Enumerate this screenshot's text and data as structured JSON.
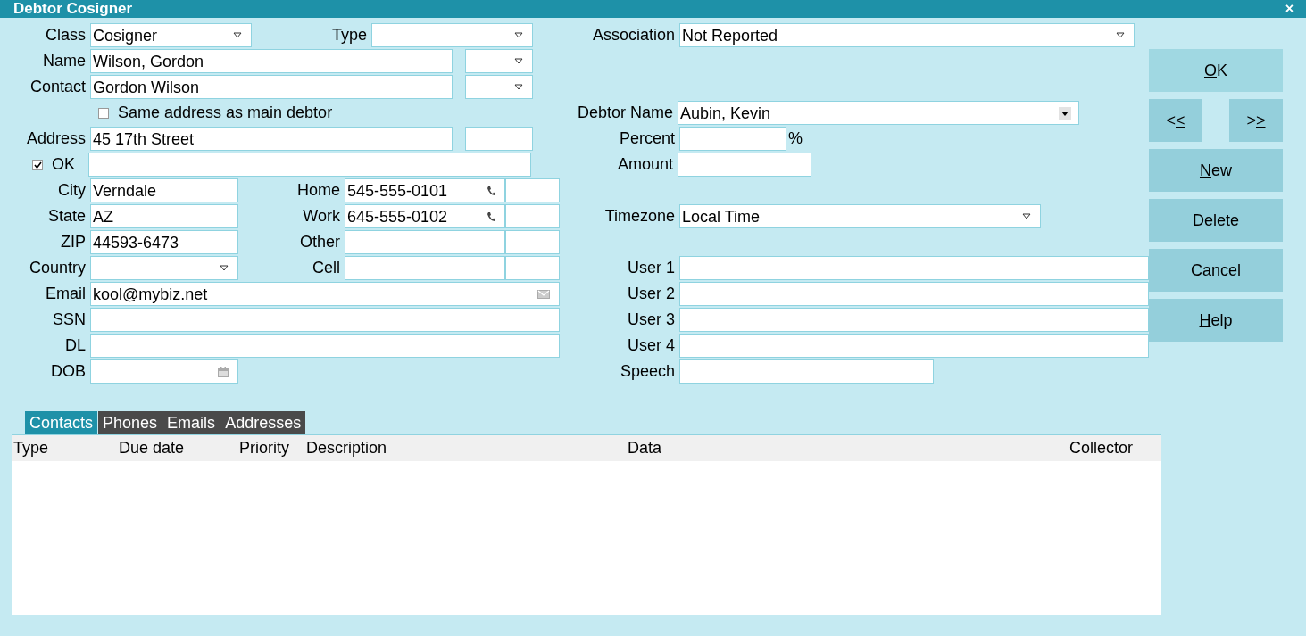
{
  "window": {
    "title": "Debtor Cosigner",
    "close": "×"
  },
  "fields": [
    {
      "label": "Class",
      "kind": "dropdown",
      "value": "Cosigner"
    },
    {
      "label": "Type",
      "kind": "dropdown"
    },
    {
      "label": "Association",
      "kind": "dropdown",
      "value": "Not Reported"
    },
    {
      "label": "Name",
      "kind": "text",
      "value": "Wilson, Gordon"
    },
    {
      "kind": "dropdown"
    },
    {
      "label": "Contact",
      "kind": "text",
      "value": "Gordon Wilson"
    },
    {
      "kind": "dropdown"
    },
    {
      "label": "Same address as main debtor",
      "kind": "checkbox",
      "checked": false
    },
    {
      "label": "Debtor Name",
      "kind": "combo",
      "value": "Aubin, Kevin"
    },
    {
      "label": "Address",
      "kind": "text",
      "value": "45 17th Street"
    },
    {
      "kind": "text"
    },
    {
      "label": "Percent",
      "kind": "text",
      "suffix": "%"
    },
    {
      "label": "OK",
      "kind": "checkbox",
      "checked": true
    },
    {
      "kind": "text"
    },
    {
      "label": "Amount",
      "kind": "text"
    },
    {
      "label": "City",
      "kind": "text",
      "value": "Verndale"
    },
    {
      "label": "Home",
      "kind": "phone",
      "value": "545-555-0101"
    },
    {
      "kind": "text"
    },
    {
      "label": "State",
      "kind": "text",
      "value": "AZ"
    },
    {
      "label": "Work",
      "kind": "phone",
      "value": "645-555-0102"
    },
    {
      "kind": "text"
    },
    {
      "label": "Timezone",
      "kind": "dropdown",
      "value": "Local Time"
    },
    {
      "label": "ZIP",
      "kind": "text",
      "value": "44593-6473"
    },
    {
      "label": "Other",
      "kind": "text"
    },
    {
      "kind": "text"
    },
    {
      "label": "Country",
      "kind": "dropdown"
    },
    {
      "label": "Cell",
      "kind": "text"
    },
    {
      "kind": "text"
    },
    {
      "label": "User 1",
      "kind": "text"
    },
    {
      "label": "Email",
      "kind": "email",
      "value": "kool@mybiz.net"
    },
    {
      "label": "User 2",
      "kind": "text"
    },
    {
      "label": "SSN",
      "kind": "text"
    },
    {
      "label": "User 3",
      "kind": "text"
    },
    {
      "label": "DL",
      "kind": "text"
    },
    {
      "label": "User 4",
      "kind": "text"
    },
    {
      "label": "DOB",
      "kind": "date"
    },
    {
      "label": "Speech",
      "kind": "text"
    }
  ],
  "buttons": [
    {
      "kind": "wide",
      "primary": true,
      "parts": [
        {
          "text": "O",
          "kind": "mnemonic"
        },
        {
          "text": "K",
          "kind": "plain"
        }
      ]
    },
    {
      "kind": "half",
      "primary": false,
      "parts": [
        {
          "text": "<",
          "kind": "plain"
        },
        {
          "text": "<",
          "kind": "mnemonic"
        }
      ]
    },
    {
      "kind": "half",
      "primary": false,
      "parts": [
        {
          "text": ">",
          "kind": "plain"
        },
        {
          "text": ">",
          "kind": "mnemonic"
        }
      ]
    },
    {
      "kind": "wide",
      "primary": false,
      "parts": [
        {
          "text": "N",
          "kind": "mnemonic"
        },
        {
          "text": "ew",
          "kind": "plain"
        }
      ]
    },
    {
      "kind": "wide",
      "primary": false,
      "parts": [
        {
          "text": "D",
          "kind": "mnemonic"
        },
        {
          "text": "elete",
          "kind": "plain"
        }
      ]
    },
    {
      "kind": "wide",
      "primary": false,
      "parts": [
        {
          "text": "C",
          "kind": "mnemonic"
        },
        {
          "text": "ancel",
          "kind": "plain"
        }
      ]
    },
    {
      "kind": "wide",
      "primary": false,
      "parts": [
        {
          "text": "H",
          "kind": "mnemonic"
        },
        {
          "text": "elp",
          "kind": "plain"
        }
      ]
    }
  ],
  "tabs": [
    {
      "label": "Contacts",
      "selected": true
    },
    {
      "label": "Phones",
      "selected": false
    },
    {
      "label": "Emails",
      "selected": false
    },
    {
      "label": "Addresses",
      "selected": false
    }
  ],
  "table": {
    "columns": [
      "Type",
      "Due date",
      "Priority",
      "Description",
      "Data",
      "Collector"
    ]
  }
}
